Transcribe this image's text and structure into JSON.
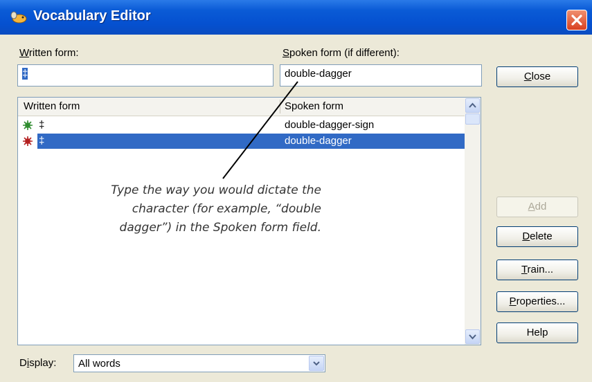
{
  "window": {
    "title": "Vocabulary Editor"
  },
  "fields": {
    "written_label_mnemonic": "W",
    "written_label_rest": "ritten form:",
    "written_value": "‡",
    "spoken_label_mnemonic": "S",
    "spoken_label_rest": "poken form (if different):",
    "spoken_value": "double-dagger"
  },
  "list": {
    "columns": [
      "Written form",
      "Spoken form"
    ],
    "rows": [
      {
        "written": "‡",
        "spoken": "double-dagger-sign",
        "selected": false
      },
      {
        "written": "‡",
        "spoken": "double-dagger",
        "selected": true
      }
    ]
  },
  "buttons": {
    "close_m": "C",
    "close_r": "lose",
    "add_m": "A",
    "add_r": "dd",
    "delete_m": "D",
    "delete_r": "elete",
    "train_m": "T",
    "train_r": "rain...",
    "properties_m": "P",
    "properties_r": "roperties...",
    "help": "Help"
  },
  "display": {
    "label_a": "D",
    "label_m": "i",
    "label_b": "splay:",
    "value": "All words"
  },
  "annotation": {
    "line1": "Type the way you would dictate the",
    "line2": "character (for example, “double",
    "line3": "dagger”) in the Spoken form field."
  },
  "colors": {
    "title_bar": "#0550d0",
    "selection": "#316ac5",
    "dialog_bg": "#ece9d8"
  },
  "icons": [
    "app-icon",
    "close-icon",
    "word-green-icon",
    "word-red-icon",
    "scroll-up-icon",
    "scroll-down-icon",
    "dropdown-arrow-icon"
  ]
}
